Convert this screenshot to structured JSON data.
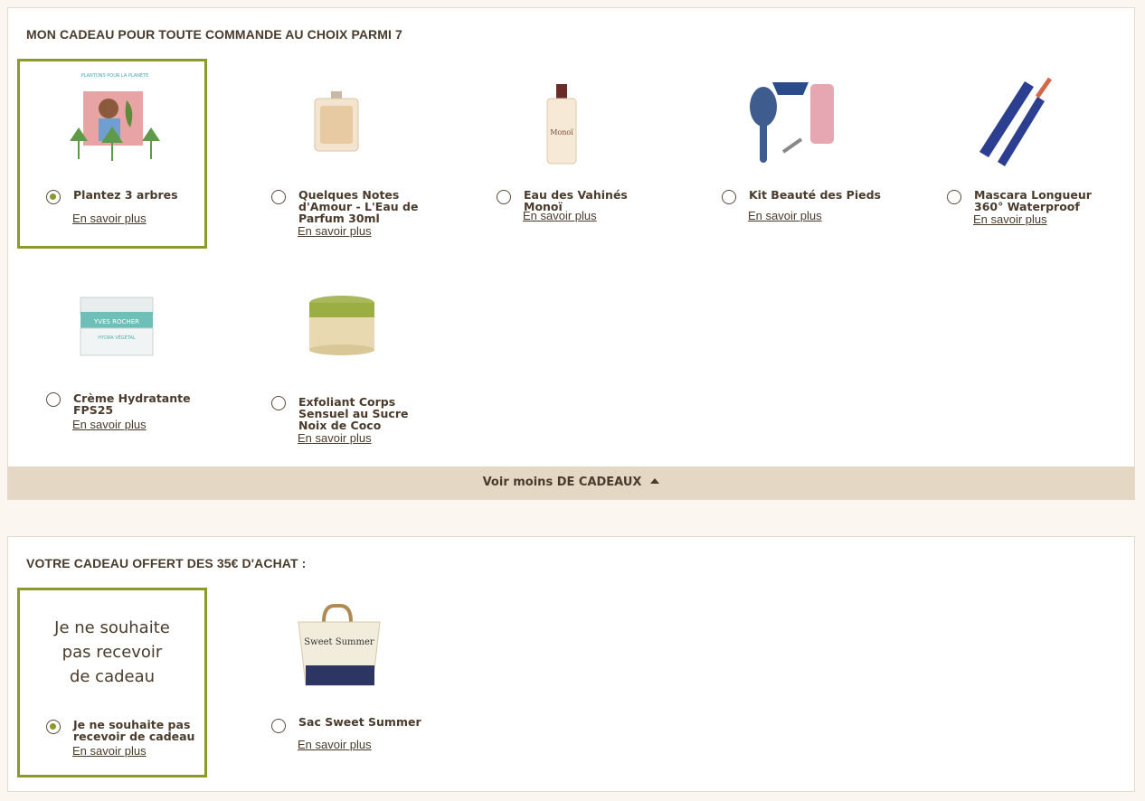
{
  "section1": {
    "title": "MON CADEAU POUR TOUTE COMMANDE AU CHOIX PARMI 7",
    "items": [
      {
        "name": "Plantez 3 arbres",
        "more": "En savoir plus",
        "selected": true,
        "image_text": "PLANTONS POUR LA PLANÈTE"
      },
      {
        "name": "Quelques Notes d'Amour - L'Eau de Parfum 30ml",
        "more": "En savoir plus",
        "selected": false
      },
      {
        "name": "Eau des Vahinés Monoï",
        "more": "En savoir plus",
        "selected": false,
        "image_text": "Monoï"
      },
      {
        "name": "Kit Beauté des Pieds",
        "more": "En savoir plus",
        "selected": false
      },
      {
        "name": "Mascara Longueur 360° Waterproof",
        "more": "En savoir plus",
        "selected": false
      },
      {
        "name": "Crème Hydratante FPS25",
        "more": "En savoir plus",
        "selected": false,
        "image_text": "YVES ROCHER",
        "image_subtext": "HYDRA VÉGÉTAL"
      },
      {
        "name": "Exfoliant Corps Sensuel au Sucre Noix de Coco",
        "more": "En savoir plus",
        "selected": false
      }
    ],
    "toggle_label": "Voir moins DE CADEAUX"
  },
  "section2": {
    "title": "VOTRE CADEAU OFFERT DES 35€ D'ACHAT :",
    "items": [
      {
        "name": "Je ne souhaite pas recevoir de cadeau",
        "more": "En savoir plus",
        "selected": true,
        "image_lines": [
          "Je ne souhaite",
          "pas recevoir",
          "de cadeau"
        ]
      },
      {
        "name": "Sac Sweet Summer",
        "more": "En savoir plus",
        "selected": false,
        "image_text": "Sweet Summer"
      }
    ]
  },
  "colors": {
    "accent": "#8a9a2b",
    "text": "#4a3b2c",
    "toggle_bg": "#e4d8c5",
    "page_bg": "#fbf6ef"
  }
}
